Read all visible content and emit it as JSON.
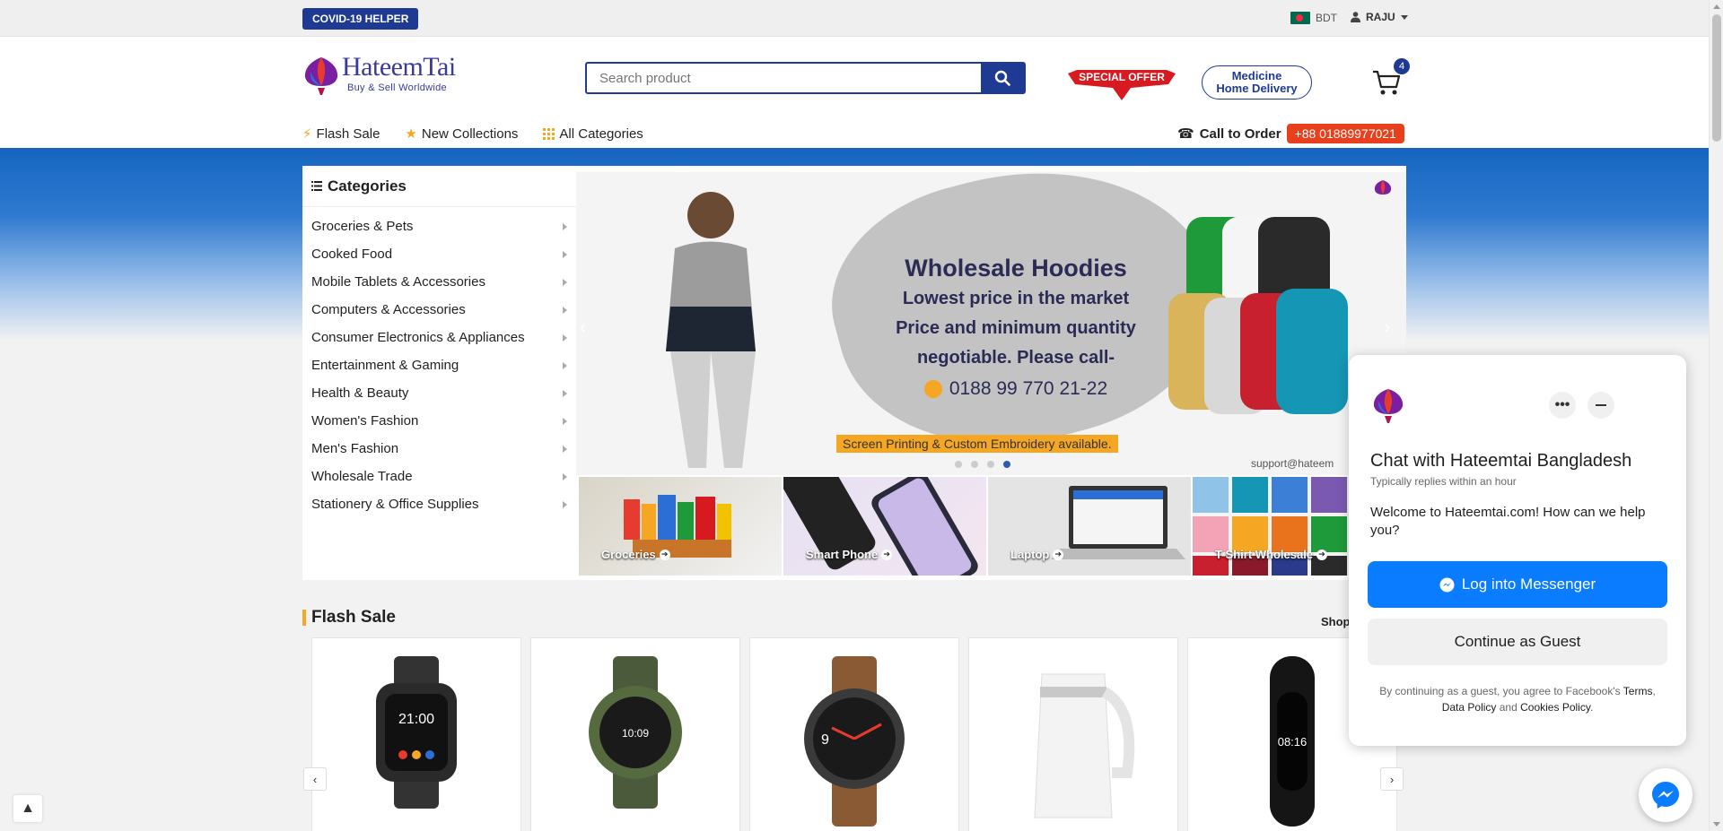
{
  "topbar": {
    "covid_label": "COVID-19 HELPER",
    "currency": "BDT",
    "user_name": "RAJU"
  },
  "header": {
    "logo_title": "HateemTai",
    "logo_tagline": "Buy & Sell Worldwide",
    "search_placeholder": "Search product",
    "special_offer": "SPECIAL OFFER",
    "medicine_line1": "Medicine",
    "medicine_line2": "Home Delivery",
    "cart_count": "4"
  },
  "nav": {
    "items": [
      "Flash Sale",
      "New Collections",
      "All Categories"
    ],
    "call_label": "Call to Order",
    "phone": "+88 01889977021"
  },
  "categories": {
    "title": "Categories",
    "items": [
      "Groceries & Pets",
      "Cooked Food",
      "Mobile Tablets & Accessories",
      "Computers & Accessories",
      "Consumer Electronics & Appliances",
      "Entertainment & Gaming",
      "Health & Beauty",
      "Women's Fashion",
      "Men's Fashion",
      "Wholesale Trade",
      "Stationery & Office Supplies"
    ]
  },
  "banner": {
    "headline": "Wholesale  Hoodies",
    "line1": "Lowest price in the market",
    "line2": "Price and minimum quantity",
    "line3": "negotiable.  Please call-",
    "phone": "0188 99 770 21-22",
    "strip": "Screen Printing & Custom Embroidery available.",
    "support": "support@hateem",
    "active_slide": 4,
    "slide_count": 4
  },
  "tiles": [
    "Groceries",
    "Smart Phone",
    "Laptop",
    "T-Shirt Wholesale"
  ],
  "flash_sale": {
    "title": "Flash Sale",
    "shop_all": "Shop"
  },
  "chat": {
    "title": "Chat with Hateemtai Bangladesh",
    "subtitle": "Typically replies within an hour",
    "welcome": "Welcome to Hateemtai.com! How can we help you?",
    "login_button": "Log into Messenger",
    "guest_button": "Continue as Guest",
    "legal_prefix": "By continuing as a guest, you agree to Facebook's",
    "legal_terms": "Terms",
    "legal_comma": ",",
    "legal_data": "Data Policy",
    "legal_and": "and",
    "legal_cookies": "Cookies Policy",
    "legal_end": "."
  },
  "colors": {
    "brand_blue": "#1f3a93",
    "accent_orange": "#e8401c",
    "messenger_blue": "#0a7cff"
  }
}
